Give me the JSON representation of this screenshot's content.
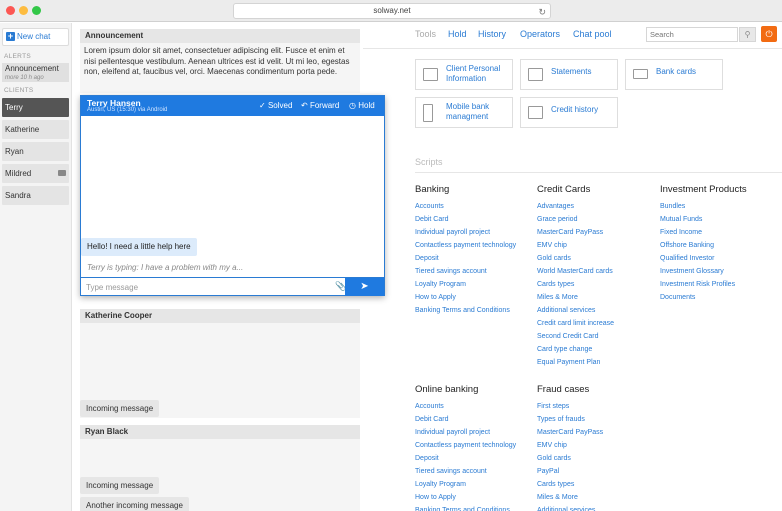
{
  "browser": {
    "url": "solway.net"
  },
  "sidebar": {
    "new_chat": "New chat",
    "alerts_label": "ALERTS",
    "announcement": {
      "title": "Announcement",
      "time": "more 10 h ago"
    },
    "clients_label": "CLIENTS",
    "clients": [
      {
        "name": "Terry",
        "active": true,
        "icon": ""
      },
      {
        "name": "Katherine",
        "active": false,
        "icon": ""
      },
      {
        "name": "Ryan",
        "active": false,
        "icon": ""
      },
      {
        "name": "Mildred",
        "active": false,
        "icon": "chat-icon"
      },
      {
        "name": "Sandra",
        "active": false,
        "icon": ""
      }
    ]
  },
  "announcement_card": {
    "title": "Announcement",
    "text": "Lorem ipsum dolor sit amet, consectetuer adipiscing elit. Fusce et enim et nisi pellentesque vestibulum. Aenean ultrices est id velit. Ut mi leo, egestas non, eleifend at, faucibus vel, orci. Maecenas condimentum porta pede."
  },
  "active_chat": {
    "name": "Terry Hansen",
    "subtitle": "Austin, US (15:30) via Android",
    "solved": "Solved",
    "forward": "Forward",
    "hold": "Hold",
    "message": "Hello! I need a little help here",
    "typing": "Terry is typing: I have a problem with my a...",
    "input_placeholder": "Type message"
  },
  "katherine_card": {
    "title": "Katherine Cooper",
    "message": "Incoming message"
  },
  "ryan_card": {
    "title": "Ryan Black",
    "messages": [
      "Incoming message",
      "Another incoming message"
    ]
  },
  "topnav": {
    "tools": "Tools",
    "hold": "Hold",
    "history": "History",
    "operators": "Operators",
    "chat_pool": "Chat pool"
  },
  "search": {
    "placeholder": "Search"
  },
  "tools": [
    {
      "label": "Client Personal Information",
      "icon": "id-card-icon"
    },
    {
      "label": "Statements",
      "icon": "statement-icon"
    },
    {
      "label": "Bank cards",
      "icon": "credit-card-icon"
    },
    {
      "label": "Mobile bank managment",
      "icon": "mobile-icon"
    },
    {
      "label": "Credit history",
      "icon": "chart-icon"
    }
  ],
  "scripts": {
    "label": "Scripts",
    "groups": [
      {
        "title": "Banking",
        "items": [
          "Accounts",
          "Debit Card",
          "Individual payroll project",
          "Contactless payment technology",
          "Deposit",
          "Tiered savings account",
          "Loyalty Program",
          "How to Apply",
          "Banking Terms and Conditions"
        ]
      },
      {
        "title": "Credit Cards",
        "items": [
          "Advantages",
          "Grace period",
          "MasterCard PayPass",
          "EMV chip",
          "Gold cards",
          "World MasterCard cards",
          "Cards types",
          "Miles & More",
          "Additional services",
          "Credit card limit increase",
          "Second Credit Card",
          "Card type change",
          "Equal Payment Plan"
        ]
      },
      {
        "title": "Investment Products",
        "items": [
          "Bundles",
          "Mutual Funds",
          "Fixed Income",
          "Offshore Banking",
          "Qualified Investor",
          "Investment Glossary",
          "Investment Risk Profiles",
          "Documents"
        ]
      },
      {
        "title": "Online banking",
        "items": [
          "Accounts",
          "Debit Card",
          "Individual payroll project",
          "Contactless payment technology",
          "Deposit",
          "Tiered savings account",
          "Loyalty Program",
          "How to Apply",
          "Banking Terms and Conditions"
        ]
      },
      {
        "title": "Fraud cases",
        "items": [
          "First steps",
          "Types of frauds",
          "MasterCard PayPass",
          "EMV chip",
          "Gold cards",
          "PayPal",
          "Cards types",
          "Miles & More",
          "Additional services"
        ]
      }
    ]
  }
}
